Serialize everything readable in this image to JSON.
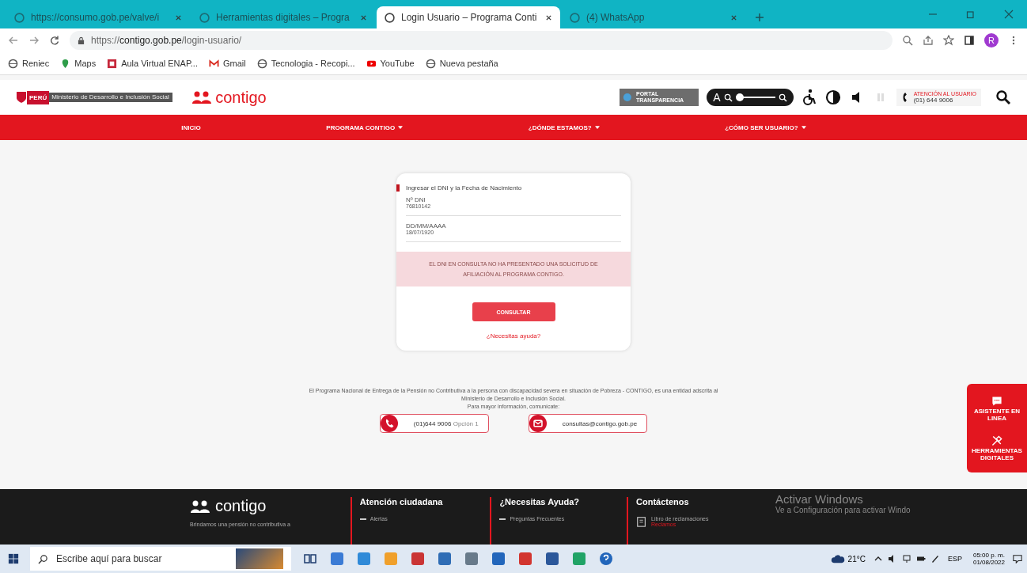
{
  "browser": {
    "tabs": [
      {
        "title": "https://consumo.gob.pe/valve/i",
        "selected": false
      },
      {
        "title": "Herramientas digitales – Progra",
        "selected": false
      },
      {
        "title": "Login Usuario – Programa Conti",
        "selected": true
      },
      {
        "title": "(4) WhatsApp",
        "selected": false
      }
    ],
    "url": {
      "scheme": "https://",
      "host": "contigo.gob.pe",
      "path": "/login-usuario/"
    },
    "profile_initial": "R",
    "bookmarks": [
      {
        "label": "Reniec",
        "kind": "globe"
      },
      {
        "label": "Maps",
        "kind": "pin"
      },
      {
        "label": "Aula Virtual ENAP...",
        "kind": "aula"
      },
      {
        "label": "Gmail",
        "kind": "gmail"
      },
      {
        "label": "Tecnologia - Recopi...",
        "kind": "globe"
      },
      {
        "label": "YouTube",
        "kind": "youtube"
      },
      {
        "label": "Nueva pestaña",
        "kind": "globe"
      }
    ]
  },
  "site": {
    "country": "PERÚ",
    "ministry": "Ministerio de Desarrollo e Inclusión Social",
    "brand": "contigo",
    "transparency": "PORTAL TRANSPARENCIA",
    "text_size_label": "A",
    "text_size": {
      "level": 0.1
    },
    "support_label": "ATENCIÓN AL USUARIO",
    "support_phone": "(01) 644 9006",
    "nav": [
      {
        "label": "INICIO",
        "dropdown": false
      },
      {
        "label": "PROGRAMA CONTIGO",
        "dropdown": true
      },
      {
        "label": "¿DÓNDE ESTAMOS?",
        "dropdown": true
      },
      {
        "label": "¿CÓMO SER USUARIO?",
        "dropdown": true
      }
    ]
  },
  "login": {
    "title": "Ingresar el DNI y la Fecha de Nacimiento",
    "fields": [
      {
        "label": "Nº DNI",
        "value": "76810142"
      },
      {
        "label": "DD/MM/AAAA",
        "value": "18/07/1920"
      }
    ],
    "error": "EL DNI EN CONSULTA NO HA PRESENTADO UNA SOLICITUD DE AFILIACIÓN AL PROGRAMA CONTIGO.",
    "button": "CONSULTAR",
    "help_link": "¿Necesitas ayuda?"
  },
  "info": {
    "lines": [
      "El Programa Nacional de Entrega de la Pensión no Contributiva a la persona con discapacidad severa en situación de Pobreza - CONTIGO, es una entidad adscrita al",
      "Ministerio de Desarrollo e Inclusión Social.",
      "Para mayor información, comunícate:"
    ],
    "phone": "(01)644 9006",
    "phone_option": "Opción 1",
    "email": "consultas@contigo.gob.pe"
  },
  "float_panel": [
    {
      "label": "ASISTENTE EN LINEA",
      "kind": "chat"
    },
    {
      "label": "HERRAMIENTAS DIGITALES",
      "kind": "tools"
    }
  ],
  "footer": {
    "brand": "contigo",
    "tagline": "Brindamos una pensión no contributiva a",
    "columns": [
      {
        "title": "Atención ciudadana",
        "item": "Alertas"
      },
      {
        "title": "¿Necesitas Ayuda?",
        "item": "Preguntas Frecuentes"
      },
      {
        "title": "Contáctenos",
        "item": "Libro de reclamaciones",
        "subitem": "Reclamos"
      }
    ]
  },
  "windows_notice": {
    "title": "Activar Windows",
    "text": "Ve a Configuración para activar Windo"
  },
  "taskbar": {
    "search_placeholder": "Escribe aquí para buscar",
    "weather": "21°C",
    "language": "ESP",
    "time": "05:00 p. m.",
    "date": "01/08/2022"
  }
}
